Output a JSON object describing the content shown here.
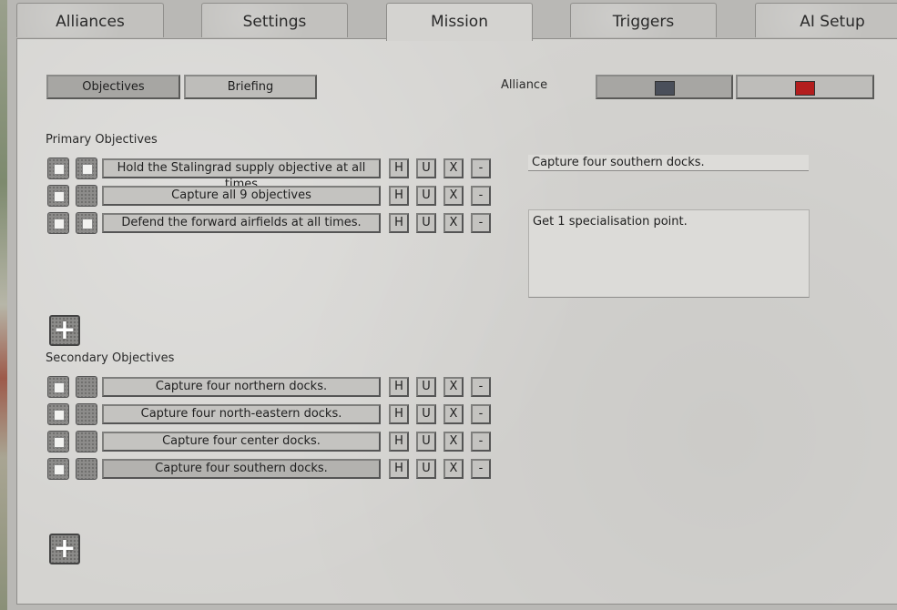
{
  "tabs": [
    {
      "label": "Alliances"
    },
    {
      "label": "Settings"
    },
    {
      "label": "Mission"
    },
    {
      "label": "Triggers"
    },
    {
      "label": "AI Setup"
    }
  ],
  "active_tab": "Mission",
  "subtabs": {
    "objectives_label": "Objectives",
    "briefing_label": "Briefing"
  },
  "alliance": {
    "label": "Alliance",
    "colors": [
      "#4a4f5a",
      "#b31e1e"
    ]
  },
  "primary": {
    "heading": "Primary Objectives",
    "items": [
      {
        "name": "Hold the Stalingrad supply objective at all times"
      },
      {
        "name": "Capture all 9 objectives"
      },
      {
        "name": "Defend the forward airfields at all times."
      }
    ]
  },
  "secondary": {
    "heading": "Secondary Objectives",
    "items": [
      {
        "name": "Capture four northern docks."
      },
      {
        "name": "Capture four north-eastern docks."
      },
      {
        "name": "Capture four center docks."
      },
      {
        "name": "Capture four southern docks."
      }
    ]
  },
  "row_buttons": {
    "h": "H",
    "u": "U",
    "x": "X",
    "minus": "-"
  },
  "add_symbol": "+",
  "detail": {
    "title_value": "Capture four southern docks.",
    "reward_value": "Get 1 specialisation point."
  }
}
